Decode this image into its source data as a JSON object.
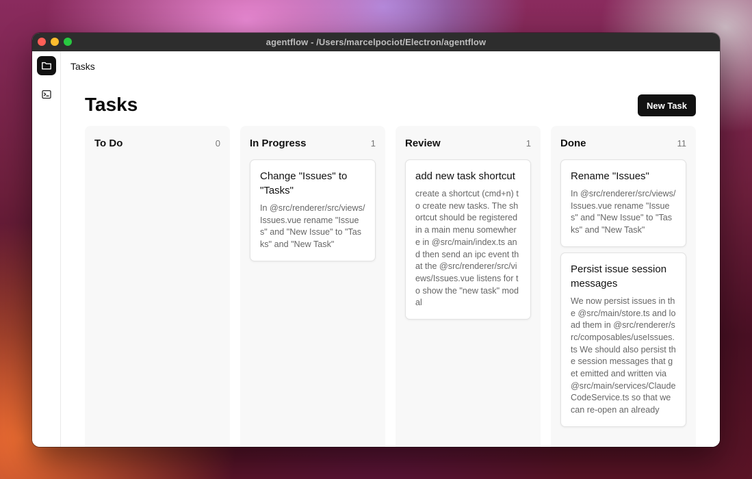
{
  "window": {
    "title": "agentflow - /Users/marcelpociot/Electron/agentflow"
  },
  "sidebar": {
    "items": [
      {
        "icon": "folder-icon",
        "active": true
      },
      {
        "icon": "terminal-icon",
        "active": false
      }
    ]
  },
  "header": {
    "breadcrumb": "Tasks",
    "page_title": "Tasks",
    "new_task_label": "New Task"
  },
  "columns": [
    {
      "title": "To Do",
      "count": "0",
      "cards": []
    },
    {
      "title": "In Progress",
      "count": "1",
      "cards": [
        {
          "title": "Change \"Issues\" to \"Tasks\"",
          "description": "In @src/renderer/src/views/Issues.vue rename \"Issues\" and \"New Issue\" to \"Tasks\" and \"New Task\""
        }
      ]
    },
    {
      "title": "Review",
      "count": "1",
      "cards": [
        {
          "title": "add new task shortcut",
          "description": "create a shortcut (cmd+n) to create new tasks. The shortcut should be registered in a main menu somewhere in @src/main/index.ts and then send an ipc event that the @src/renderer/src/views/Issues.vue listens for to show the \"new task\" modal"
        }
      ]
    },
    {
      "title": "Done",
      "count": "11",
      "cards": [
        {
          "title": "Rename \"Issues\"",
          "description": "In @src/renderer/src/views/Issues.vue rename \"Issues\" and \"New Issue\" to \"Tasks\" and \"New Task\""
        },
        {
          "title": "Persist issue session messages",
          "description": "We now persist issues in the @src/main/store.ts and load them in @src/renderer/src/composables/useIssues.ts We should also persist the session messages that get emitted and written via @src/main/services/ClaudeCodeService.ts so that we can re-open an already"
        }
      ]
    }
  ]
}
